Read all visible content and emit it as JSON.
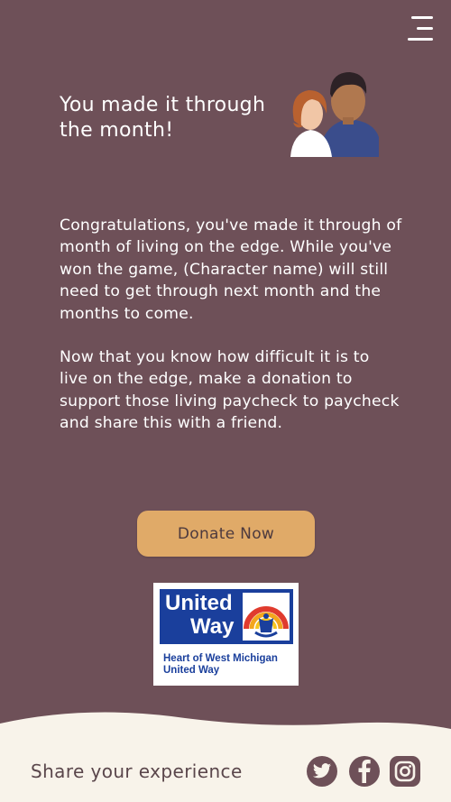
{
  "header": {
    "menu_icon": "hamburger-menu-icon"
  },
  "main": {
    "title": "You made it through the month!",
    "illustration": "couple-illustration",
    "paragraphs": [
      "Congratulations, you've made it through of month of living on the edge. While you've won the game, (Character name) will still need to get through next month and the months to come.",
      "Now that you know how difficult it is to live on the edge, make a donation to support those living paycheck to paycheck and share this with a friend."
    ],
    "donate_label": "Donate Now"
  },
  "logo": {
    "line1": "United",
    "line2": "Way",
    "sub1": "Heart of West Michigan",
    "sub2": "United Way",
    "brand_color": "#1a3f9c"
  },
  "footer": {
    "share_label": "Share your experience",
    "social": [
      {
        "name": "twitter-icon"
      },
      {
        "name": "facebook-icon"
      },
      {
        "name": "instagram-icon"
      }
    ]
  },
  "colors": {
    "background": "#6e5058",
    "accent": "#e0aa68",
    "footer": "#f8f3ea"
  }
}
